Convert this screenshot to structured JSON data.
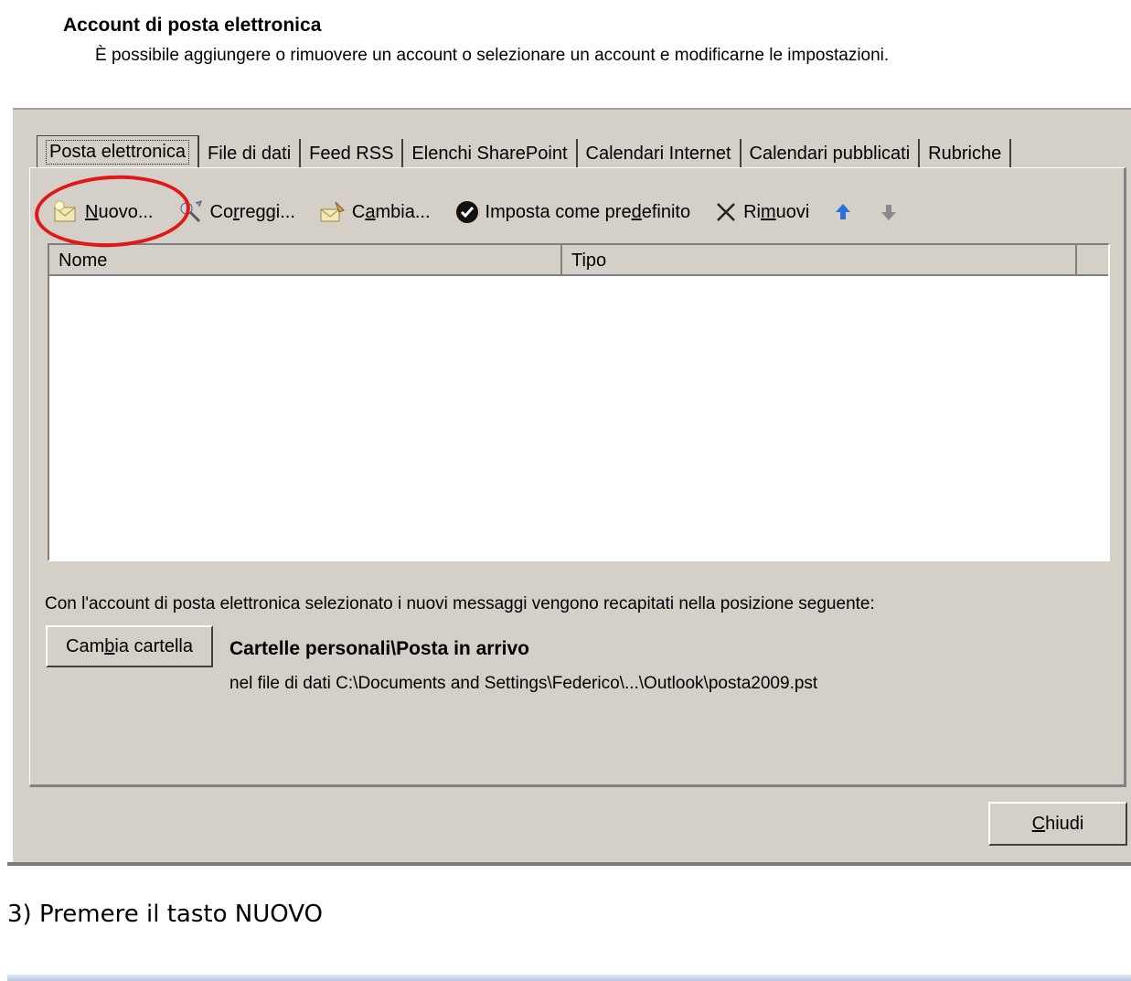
{
  "header": {
    "title": "Account di posta elettronica",
    "description": "È possibile aggiungere o rimuovere un account o selezionare un account e modificarne le impostazioni."
  },
  "tabs": [
    {
      "label": "Posta elettronica",
      "active": true
    },
    {
      "label": "File di dati"
    },
    {
      "label": "Feed RSS"
    },
    {
      "label": "Elenchi SharePoint"
    },
    {
      "label": "Calendari Internet"
    },
    {
      "label": "Calendari pubblicati"
    },
    {
      "label": "Rubriche"
    }
  ],
  "toolbar": {
    "new_pre": "",
    "new_u": "N",
    "new_post": "uovo...",
    "repair_pre": "Co",
    "repair_u": "r",
    "repair_post": "reggi...",
    "change_pre": "C",
    "change_u": "a",
    "change_post": "mbia...",
    "default_pre": "Imposta come pre",
    "default_u": "d",
    "default_post": "efinito",
    "remove_pre": "Ri",
    "remove_u": "m",
    "remove_post": "uovi",
    "icons": [
      "new-account-icon",
      "repair-icon",
      "change-icon",
      "check-circle-icon",
      "remove-x-icon",
      "arrow-up-icon",
      "arrow-down-icon"
    ],
    "colors": {
      "arrow_up": "#2a6fdc",
      "arrow_down": "#8a8a8a",
      "highlight": "#e01818"
    }
  },
  "list": {
    "columns": [
      "Nome",
      "Tipo"
    ],
    "rows": []
  },
  "delivery": {
    "info": "Con l'account di posta elettronica selezionato i nuovi messaggi vengono recapitati nella posizione seguente:",
    "change_folder_pre": "Cam",
    "change_folder_u": "b",
    "change_folder_post": "ia cartella",
    "folder": "Cartelle personali\\Posta in arrivo",
    "path": "nel file di dati C:\\Documents and Settings\\Federico\\...\\Outlook\\posta2009.pst"
  },
  "footer": {
    "close_u": "C",
    "close_post": "hiudi"
  },
  "caption": "3)  Premere il tasto NUOVO"
}
